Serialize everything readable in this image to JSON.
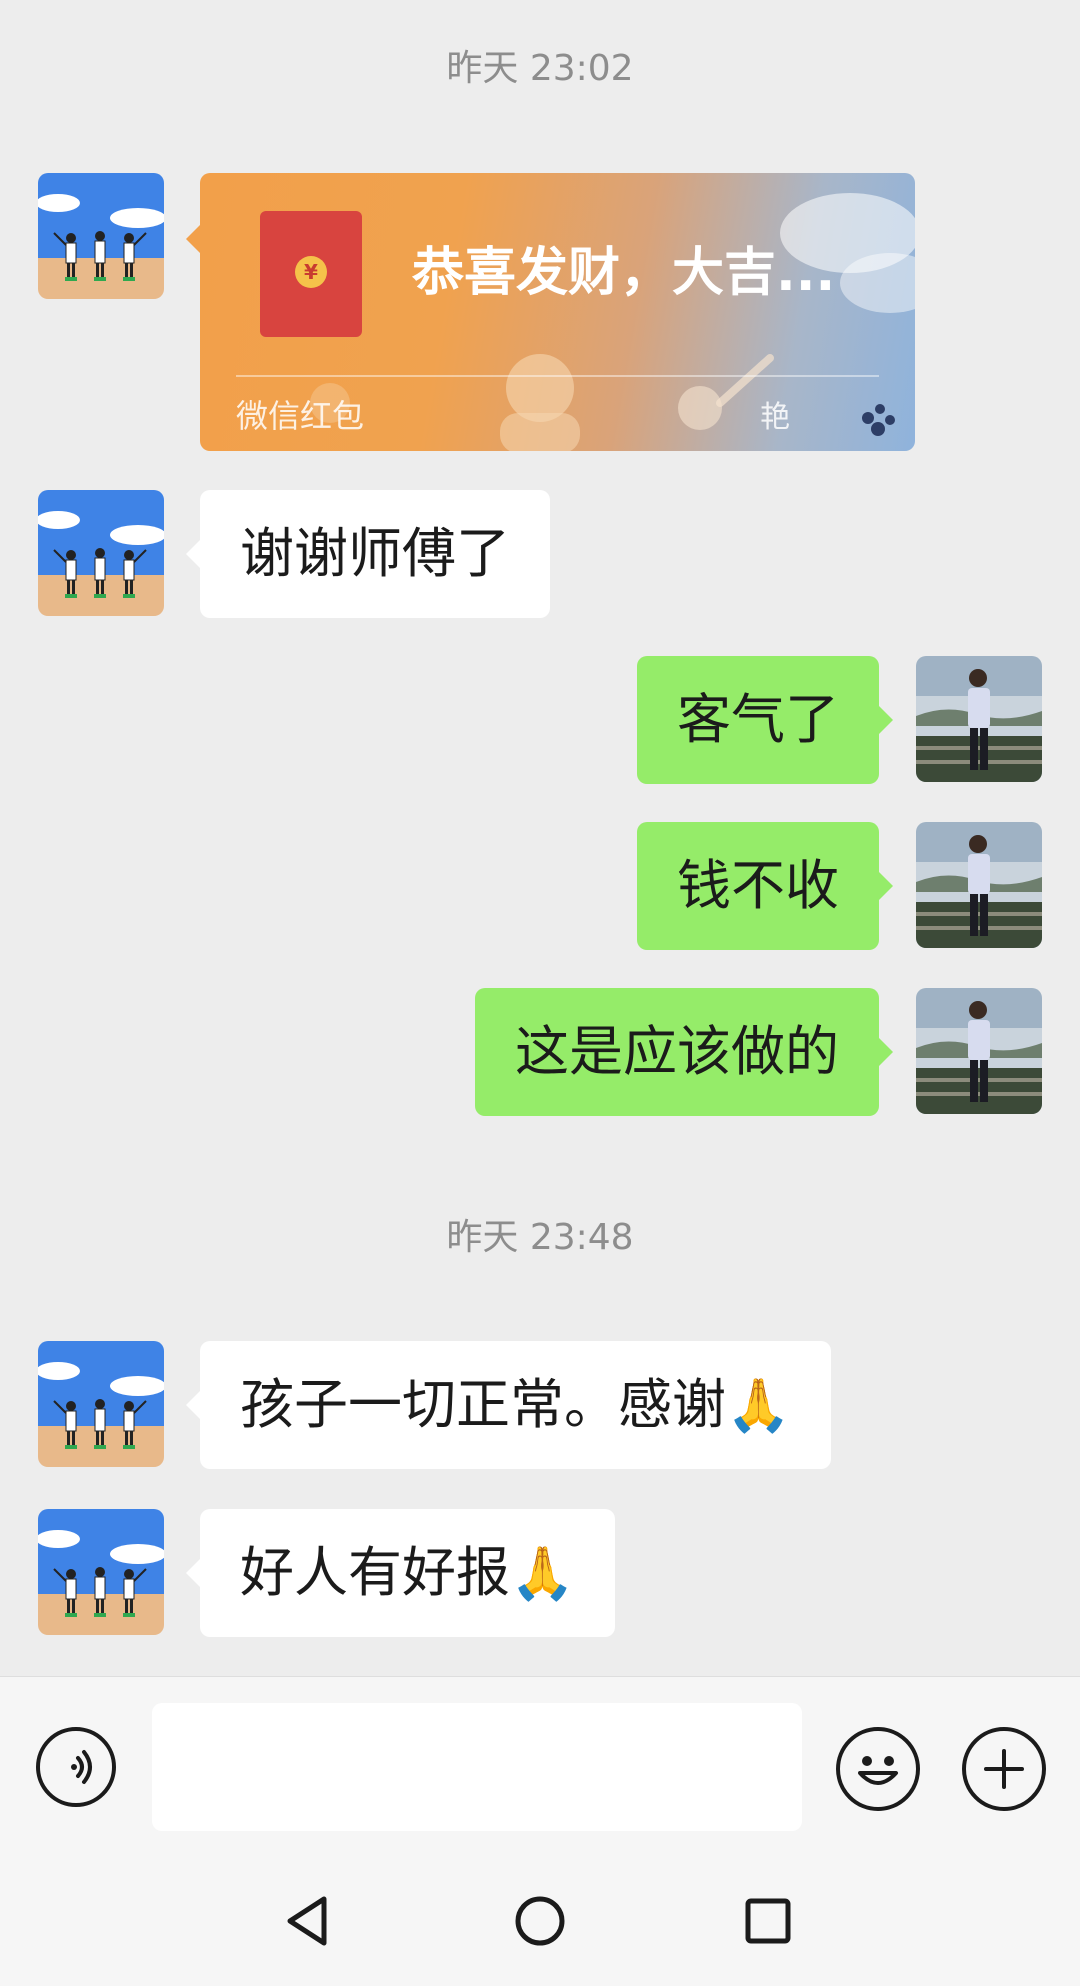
{
  "chat": {
    "timestamps": [
      "昨天 23:02",
      "昨天 23:48"
    ],
    "red_packet": {
      "title": "恭喜发财，大吉...",
      "label": "微信红包",
      "coin_symbol": "¥",
      "art_text": "艳"
    },
    "messages": [
      {
        "side": "in",
        "text": "谢谢师傅了"
      },
      {
        "side": "out",
        "text": "客气了"
      },
      {
        "side": "out",
        "text": "钱不收"
      },
      {
        "side": "out",
        "text": "这是应该做的"
      },
      {
        "side": "in",
        "text": "孩子一切正常。感谢",
        "emoji": "🙏"
      },
      {
        "side": "in",
        "text": "好人有好报",
        "emoji": "🙏"
      }
    ]
  },
  "input_bar": {
    "voice_icon": "voice-icon",
    "emoji_icon": "smiley-icon",
    "more_icon": "plus-icon",
    "text_value": ""
  },
  "nav_bar": {
    "icons": [
      "back-triangle-icon",
      "home-circle-icon",
      "recents-square-icon"
    ]
  },
  "colors": {
    "background": "#ededed",
    "outgoing": "#95ec69",
    "incoming": "#ffffff"
  }
}
